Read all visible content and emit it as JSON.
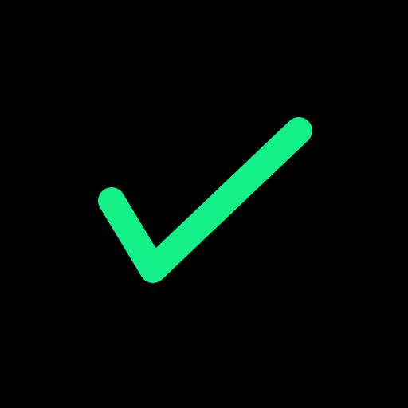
{
  "screen": {
    "background_color": "#000000"
  },
  "checkmark": {
    "icon": "checkmark-icon",
    "color": "#12F087"
  }
}
